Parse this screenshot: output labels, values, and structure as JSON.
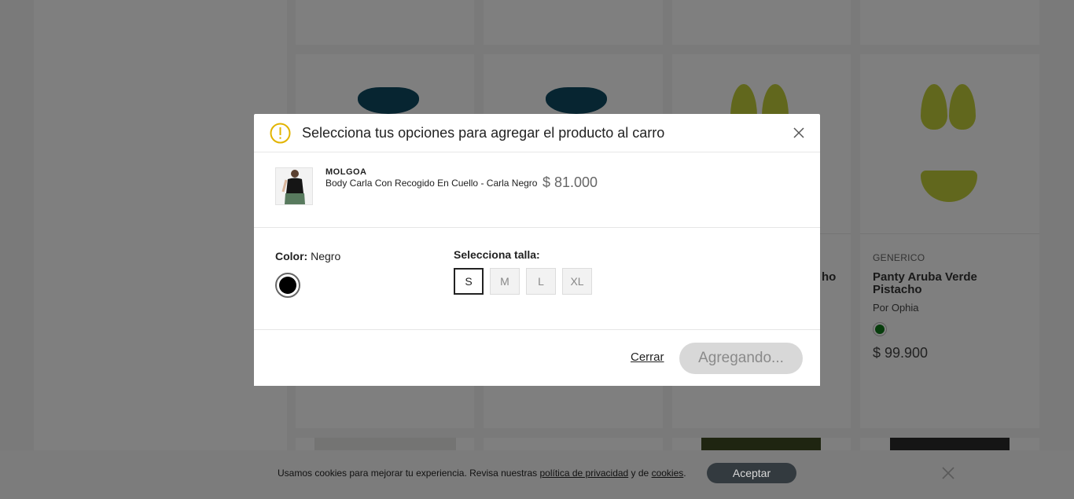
{
  "background": {
    "visible_card": {
      "brand": "GENERICO",
      "title": "Panty Aruba Verde Pistacho",
      "seller": "Por Ophia",
      "price": "$ 99.900",
      "swatch_color": "#0e7a19"
    },
    "partial_title_fragment": "ho"
  },
  "cookie_bar": {
    "text_prefix": "Usamos cookies para mejorar tu experiencia. Revisa nuestras ",
    "privacy_link": "política de privacidad",
    "text_middle": " y de ",
    "cookies_link": "cookies",
    "text_suffix": ".",
    "accept_label": "Aceptar"
  },
  "modal": {
    "title": "Selecciona tus opciones para agregar el producto al carro",
    "product": {
      "brand": "MOLGOA",
      "name": "Body Carla Con Recogido En Cuello - Carla Negro",
      "price": "$ 81.000"
    },
    "color": {
      "label": "Color:",
      "value": "Negro",
      "swatch": "#000000"
    },
    "size": {
      "label": "Selecciona talla:",
      "options": [
        "S",
        "M",
        "L",
        "XL"
      ],
      "selected": "S"
    },
    "footer": {
      "close_label": "Cerrar",
      "submit_label": "Agregando..."
    }
  },
  "colors": {
    "warning": "#e2b400",
    "overlay": "rgba(0,0,0,0.5)",
    "accent_dark": "#333a3f"
  }
}
